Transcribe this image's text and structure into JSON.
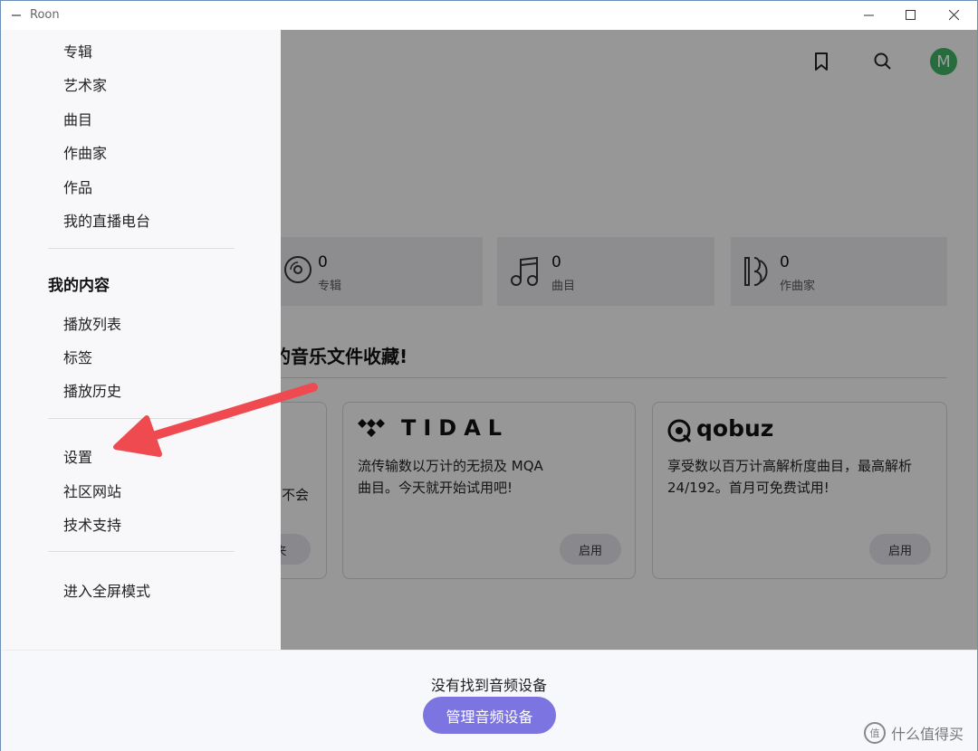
{
  "window": {
    "title": "Roon"
  },
  "sidebar": {
    "library_items": [
      "专辑",
      "艺术家",
      "曲目",
      "作曲家",
      "作品",
      "我的直播电台"
    ],
    "my_content": {
      "heading": "我的内容",
      "items": [
        "播放列表",
        "标签",
        "播放历史"
      ]
    },
    "system_items": [
      "设置",
      "社区网站",
      "技术支持"
    ],
    "fullscreen": "进入全屏模式"
  },
  "header": {
    "avatar_initial": "M"
  },
  "stats": [
    {
      "count": "0",
      "label": "专辑",
      "icon": "album-disc-icon"
    },
    {
      "count": "0",
      "label": "曲目",
      "icon": "music-note-icon"
    },
    {
      "count": "0",
      "label": "作曲家",
      "icon": "composer-icon"
    }
  ],
  "collection_heading": "的音乐文件收藏!",
  "services": {
    "partial": {
      "desc_fragment": "不会",
      "button_fragment": "夹"
    },
    "tidal": {
      "logo_text": "TIDAL",
      "description": "流传输数以万计的无损及 MQA\n曲目。今天就开始试用吧!",
      "button": "启用"
    },
    "qobuz": {
      "logo_text": "qobuz",
      "description": "享受数以百万计高解析度曲目，最高解析\n24/192。首月可免费试用!",
      "button": "启用"
    }
  },
  "bottom": {
    "status": "没有找到音频设备",
    "manage_button": "管理音频设备"
  },
  "watermark": {
    "text": "什么值得买",
    "glyph": "值"
  },
  "colors": {
    "accent": "#7c74e0",
    "avatar": "#3fae63",
    "annotation_arrow": "#ef4a4f"
  }
}
